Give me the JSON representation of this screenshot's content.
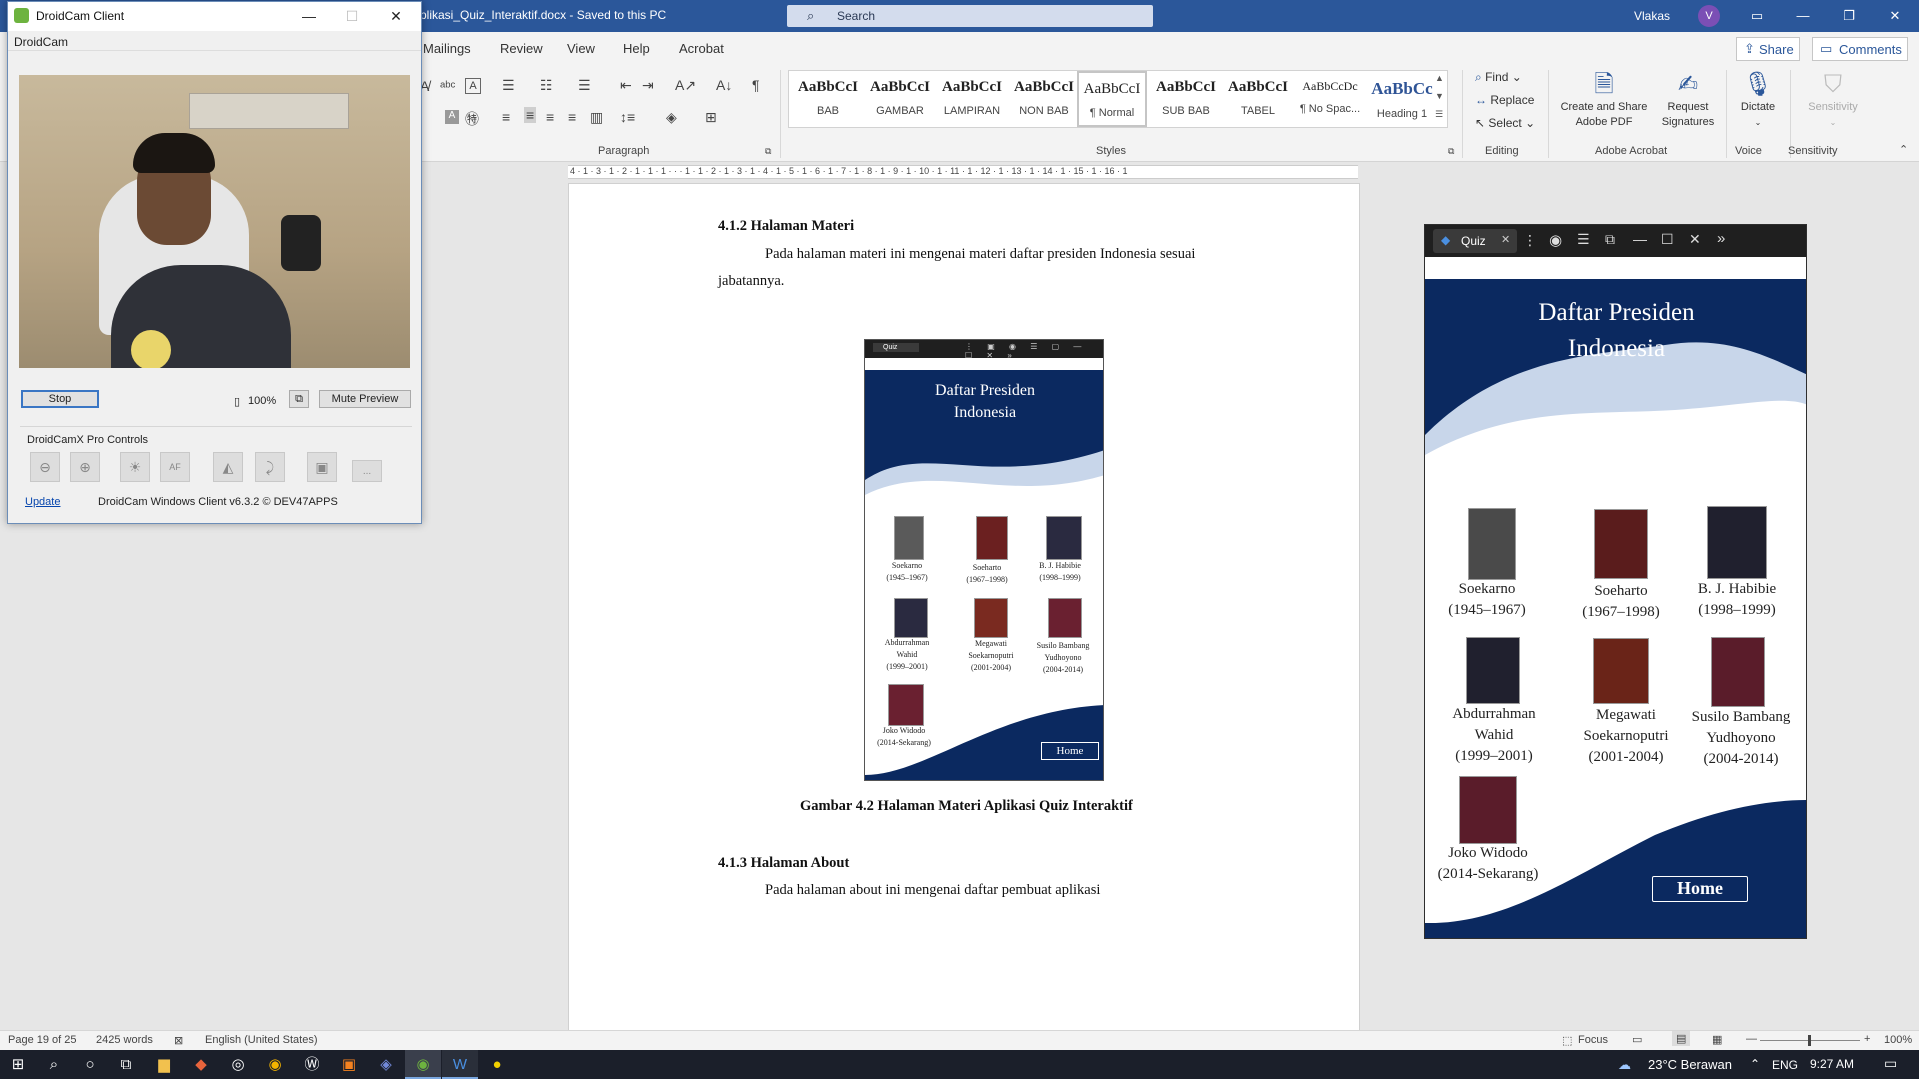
{
  "word": {
    "doc_title": "plikasi_Quiz_Interaktif.docx  -  Saved to this PC",
    "search_placeholder": "Search",
    "user_name": "Vlakas",
    "user_initial": "V",
    "tabs": [
      "Mailings",
      "Review",
      "View",
      "Help",
      "Acrobat"
    ],
    "share_label": "Share",
    "comments_label": "Comments",
    "groups": {
      "paragraph": "Paragraph",
      "styles": "Styles",
      "editing": "Editing",
      "acrobat": "Adobe Acrobat",
      "voice": "Voice",
      "sensitivity": "Sensitivity"
    },
    "styles": [
      {
        "preview": "AaBbCcI",
        "name": "BAB"
      },
      {
        "preview": "AaBbCcI",
        "name": "GAMBAR"
      },
      {
        "preview": "AaBbCcI",
        "name": "LAMPIRAN"
      },
      {
        "preview": "AaBbCcI",
        "name": "NON BAB"
      },
      {
        "preview": "AaBbCcI",
        "name": "¶ Normal"
      },
      {
        "preview": "AaBbCcI",
        "name": "SUB BAB"
      },
      {
        "preview": "AaBbCcI",
        "name": "TABEL"
      },
      {
        "preview": "AaBbCcDc",
        "name": "¶ No Spac..."
      },
      {
        "preview": "AaBbCc",
        "name": "Heading 1"
      }
    ],
    "editing": {
      "find": "Find",
      "replace": "Replace",
      "select": "Select"
    },
    "acrobat": {
      "create": "Create and Share\nAdobe PDF",
      "request": "Request\nSignatures"
    },
    "voice": {
      "dictate": "Dictate"
    },
    "sensitivity_btn": "Sensitivity",
    "ruler": "4 · 1 · 3 · 1 · 2 · 1 · 1 · 1 · · · 1 · 1 · 2 · 1 · 3 · 1 · 4 · 1 · 5 · 1 · 6 · 1 · 7 · 1 · 8 · 1 · 9 · 1 · 10 · 1 · 11 · 1 · 12 · 1 · 13 · 1 · 14 · 1 · 15 · 1 · 16 · 1"
  },
  "document": {
    "h1": "4.1.2 Halaman Materi",
    "p1_line1": "Pada halaman materi ini mengenai materi daftar presiden Indonesia sesuai",
    "p1_line2": "jabatannya.",
    "caption": "Gambar 4.2 Halaman Materi Aplikasi Quiz Interaktif",
    "h2": "4.1.3 Halaman About",
    "p2": "Pada halaman about ini mengenai daftar pembuat aplikasi"
  },
  "quiz": {
    "tab_title": "Quiz",
    "heading_line1": "Daftar Presiden",
    "heading_line2": "Indonesia",
    "presidents": [
      {
        "name": "Soekarno",
        "years": "(1945–1967)"
      },
      {
        "name": "Soeharto",
        "years": "(1967–1998)"
      },
      {
        "name": "B. J. Habibie",
        "years": "(1998–1999)"
      },
      {
        "name": "Abdurrahman\nWahid",
        "years": "(1999–2001)"
      },
      {
        "name": "Megawati\nSoekarnoputri",
        "years": "(2001-2004)"
      },
      {
        "name": "Susilo Bambang\nYudhoyono",
        "years": "(2004-2014)"
      },
      {
        "name": "Joko Widodo",
        "years": "(2014-Sekarang)"
      }
    ],
    "home_label": "Home"
  },
  "droidcam": {
    "title": "DroidCam Client",
    "menu": "DroidCam",
    "stop_label": "Stop",
    "zoom": "100%",
    "mute_label": "Mute Preview",
    "pro_controls": "DroidCamX Pro Controls",
    "af_label": "AF",
    "more_label": "...",
    "update_link": "Update",
    "version": "DroidCam Windows Client v6.3.2 © DEV47APPS"
  },
  "statusbar": {
    "page": "Page 19 of 25",
    "words": "2425 words",
    "language": "English (United States)",
    "focus": "Focus",
    "zoom": "100%"
  },
  "taskbar": {
    "weather": "23°C  Berawan",
    "lang": "ENG",
    "time": "9:27 AM"
  },
  "icons": [
    "windows-start-icon",
    "search-icon",
    "cortana-icon",
    "task-view-icon",
    "file-explorer-icon",
    "app-icon",
    "obs-icon",
    "chrome-icon",
    "app-icon",
    "app-icon",
    "discord-icon",
    "droidcam-icon",
    "word-icon",
    "app-icon"
  ]
}
